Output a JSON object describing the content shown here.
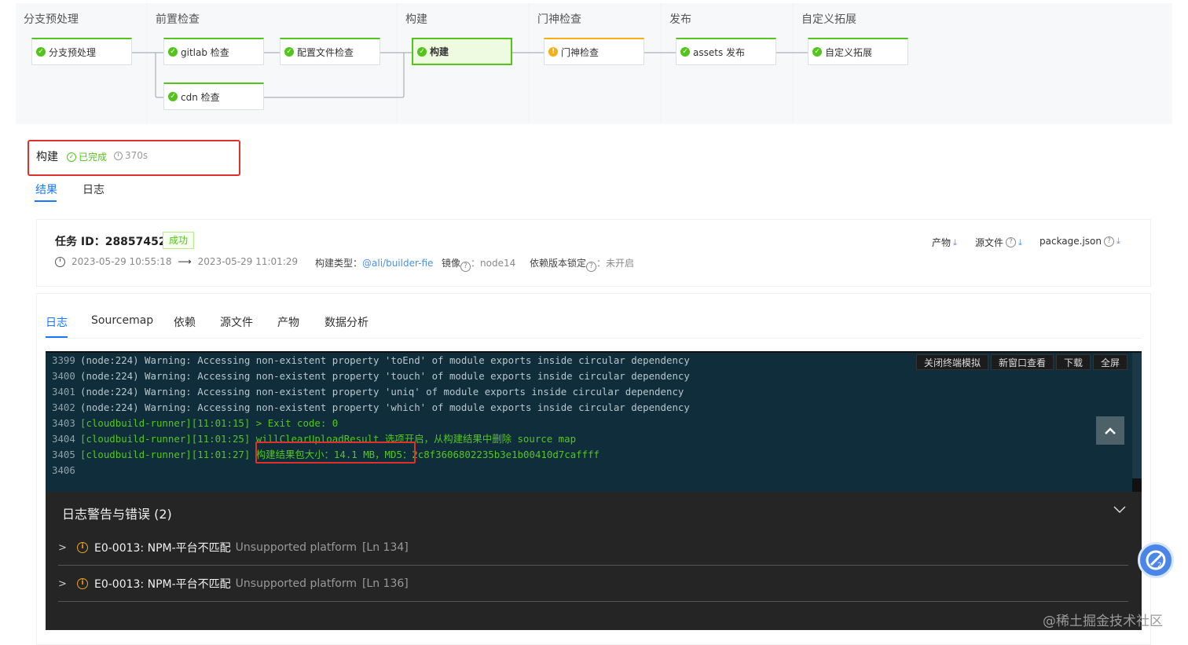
{
  "pipeline": {
    "stages": [
      {
        "title": "分支预处理"
      },
      {
        "title": "前置检查"
      },
      {
        "title": "构建"
      },
      {
        "title": "门神检查"
      },
      {
        "title": "发布"
      },
      {
        "title": "自定义拓展"
      }
    ],
    "nodes": {
      "branch_preprocess": "分支预处理",
      "gitlab_check": "gitlab 检查",
      "config_check": "配置文件检查",
      "cdn_check": "cdn 检查",
      "build": "构建",
      "gate_check": "门神检查",
      "assets_publish": "assets 发布",
      "custom_extend": "自定义拓展"
    },
    "colors": {
      "success": "#52c41a",
      "warning": "#faad14"
    }
  },
  "step": {
    "title": "构建",
    "status": "已完成",
    "duration": "370s"
  },
  "result_tabs": {
    "result": "结果",
    "log": "日志"
  },
  "task": {
    "id_label": "任务 ID：28857452",
    "status_badge": "成功",
    "start_time": "2023-05-29 10:55:18",
    "arrow": "⟶",
    "end_time": "2023-05-29 11:01:29",
    "build_type_label": "构建类型：",
    "build_type_value": "@ali/builder-fie",
    "image_label": "镜像",
    "image_value": "：node14",
    "lock_label": "依赖版本锁定",
    "lock_value": "：未开启",
    "downloads": {
      "artifact": "产物",
      "source": "源文件",
      "package": "package.json"
    }
  },
  "log_tabs": [
    "日志",
    "Sourcemap",
    "依赖",
    "源文件",
    "产物",
    "数据分析"
  ],
  "terminal": {
    "tools": [
      "关闭终端模拟",
      "新窗口查看",
      "下载",
      "全屏"
    ],
    "lines": [
      {
        "n": "3399",
        "text": "(node:224) Warning: Accessing non-existent property 'toEnd' of module exports inside circular dependency"
      },
      {
        "n": "3400",
        "text": "(node:224) Warning: Accessing non-existent property 'touch' of module exports inside circular dependency"
      },
      {
        "n": "3401",
        "text": "(node:224) Warning: Accessing non-existent property 'uniq' of module exports inside circular dependency"
      },
      {
        "n": "3402",
        "text": "(node:224) Warning: Accessing non-existent property 'which' of module exports inside circular dependency"
      },
      {
        "n": "3403",
        "text": "[cloudbuild-runner][11:01:15] > Exit code: 0"
      },
      {
        "n": "3404",
        "text": "[cloudbuild-runner][11:01:25] willClearUploadResult 选项开启，从构建结果中删除 source map"
      },
      {
        "n": "3405",
        "text": "[cloudbuild-runner][11:01:27] 构建结果包大小：14.1 MB，MD5：2c8f3606802235b3e1b00410d7caffff"
      },
      {
        "n": "3406",
        "text": ""
      }
    ],
    "colors": {
      "bg": "#0f2d3a",
      "green": "#53c71c",
      "gray": "#b9c6cc"
    }
  },
  "warnings": {
    "title": "日志警告与错误 (2)",
    "items": [
      {
        "code": "E0-0013: NPM-平台不匹配",
        "desc": "Unsupported platform",
        "ln": "[Ln 134]"
      },
      {
        "code": "E0-0013: NPM-平台不匹配",
        "desc": "Unsupported platform",
        "ln": "[Ln 136]"
      }
    ]
  },
  "watermark": "@稀土掘金技术社区"
}
